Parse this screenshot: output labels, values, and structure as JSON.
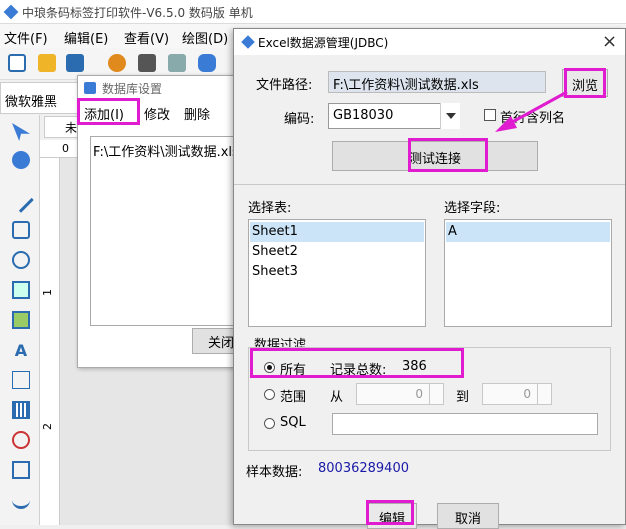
{
  "app": {
    "title": "中琅条码标签打印软件-V6.5.0 数码版 单机",
    "menu": [
      "文件(F)",
      "编辑(E)",
      "查看(V)",
      "绘图(D)"
    ],
    "font_name": "微软雅黑",
    "doc_tab": "未",
    "ruler_marks": [
      "0",
      "1",
      "2"
    ]
  },
  "db_dialog": {
    "title": "数据库设置",
    "menu": {
      "add": "添加(I)",
      "modify": "修改",
      "delete": "删除"
    },
    "list_items": [
      "F:\\工作资料\\测试数据.xls"
    ],
    "close_label": "关闭"
  },
  "excel_dialog": {
    "title": "Excel数据源管理(JDBC)",
    "close_glyph": "×",
    "path_label": "文件路径:",
    "path_value": "F:\\工作资料\\测试数据.xls",
    "browse_label": "浏览",
    "encoding_label": "编码:",
    "encoding_value": "GB18030",
    "header_checkbox_label": "首行含列名",
    "test_button_label": "测试连接",
    "select_table_label": "选择表:",
    "tables": [
      "Sheet1",
      "Sheet2",
      "Sheet3"
    ],
    "selected_table": "Sheet1",
    "select_field_label": "选择字段:",
    "fields": [
      "A"
    ],
    "filter_group_label": "数据过滤",
    "filter_all_label": "所有",
    "record_count_label": "记录总数:",
    "record_count_value": "386",
    "filter_range_label": "范围",
    "range_from_label": "从",
    "range_from_value": "0",
    "range_to_label": "到",
    "range_to_value": "0",
    "filter_sql_label": "SQL",
    "sample_label": "样本数据:",
    "sample_value": "80036289400",
    "edit_button_label": "编辑",
    "cancel_button_label": "取消"
  },
  "colors": {
    "highlight": "#e01bd0",
    "selection": "#cce4f7",
    "sample_value": "#1a1aa8"
  }
}
